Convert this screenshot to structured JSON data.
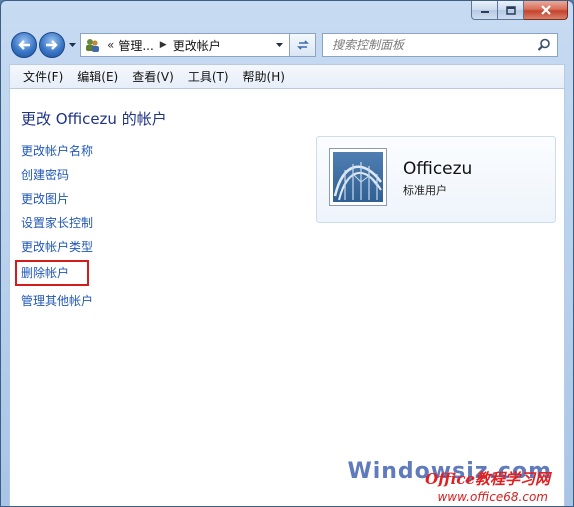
{
  "window": {
    "caption_buttons": [
      "minimize-icon",
      "maximize-icon",
      "close-icon"
    ]
  },
  "nav": {
    "back_icon": "back-arrow-icon",
    "forward_icon": "forward-arrow-icon",
    "address": {
      "overflow": "«",
      "segments": [
        "管理...",
        "更改帐户"
      ]
    },
    "search_placeholder": "搜索控制面板"
  },
  "menu": [
    "文件(F)",
    "编辑(E)",
    "查看(V)",
    "工具(T)",
    "帮助(H)"
  ],
  "main": {
    "title": "更改 Officezu 的帐户",
    "tasks": [
      {
        "label": "更改帐户名称"
      },
      {
        "label": "创建密码"
      },
      {
        "label": "更改图片"
      },
      {
        "label": "设置家长控制"
      },
      {
        "label": "更改帐户类型"
      },
      {
        "label": "删除帐户",
        "highlighted": true
      },
      {
        "label": "管理其他帐户"
      }
    ],
    "user": {
      "name": "Officezu",
      "type": "标准用户"
    }
  },
  "watermark": {
    "site": "Windowsjz.com",
    "brand": "Office教程学习网",
    "url": "www.office68.com"
  },
  "colors": {
    "link": "#1f57b7",
    "title": "#1e3287",
    "highlight_border": "#d51c1c"
  }
}
